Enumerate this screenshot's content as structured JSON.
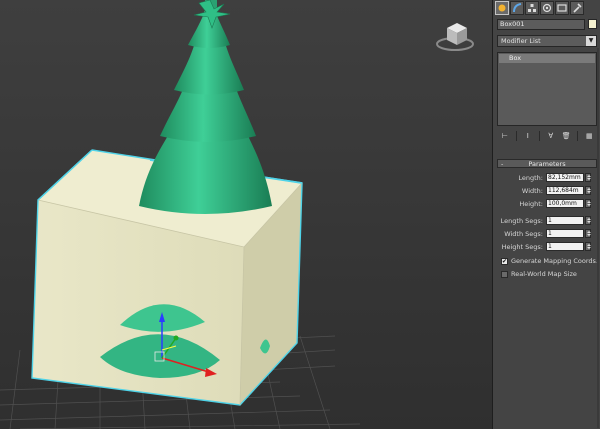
{
  "viewport": {
    "viewcube": "viewcube-icon",
    "objects": [
      "christmas-tree",
      "star",
      "box",
      "hemisphere-cut",
      "transform-gizmo"
    ]
  },
  "command_panel": {
    "tabs": [
      {
        "icon": "create-sphere-icon",
        "active": true
      },
      {
        "icon": "modify-icon",
        "active": false
      },
      {
        "icon": "hierarchy-icon",
        "active": false
      },
      {
        "icon": "motion-icon",
        "active": false
      },
      {
        "icon": "display-icon",
        "active": false
      },
      {
        "icon": "utilities-icon",
        "active": false
      }
    ],
    "object_name": "Box001",
    "object_color": "#f4f1cf",
    "modifier_list": "Modifier List",
    "stack": [
      "Box"
    ],
    "parameters": {
      "title": "Parameters",
      "length_label": "Length:",
      "length_value": "82,152mm",
      "width_label": "Width:",
      "width_value": "112,684m",
      "height_label": "Height:",
      "height_value": "100,0mm",
      "length_segs_label": "Length Segs:",
      "length_segs_value": "1",
      "width_segs_label": "Width Segs:",
      "width_segs_value": "1",
      "height_segs_label": "Height Segs:",
      "height_segs_value": "1",
      "gen_mapping_label": "Generate Mapping Coords.",
      "gen_mapping_checked": true,
      "real_world_label": "Real-World Map Size",
      "real_world_checked": false
    }
  },
  "colors": {
    "viewport_bg": "#3b3b3b",
    "tree_green": "#2fae7c",
    "box_face": "#e6e4c4",
    "selection": "#4fd3e8"
  }
}
